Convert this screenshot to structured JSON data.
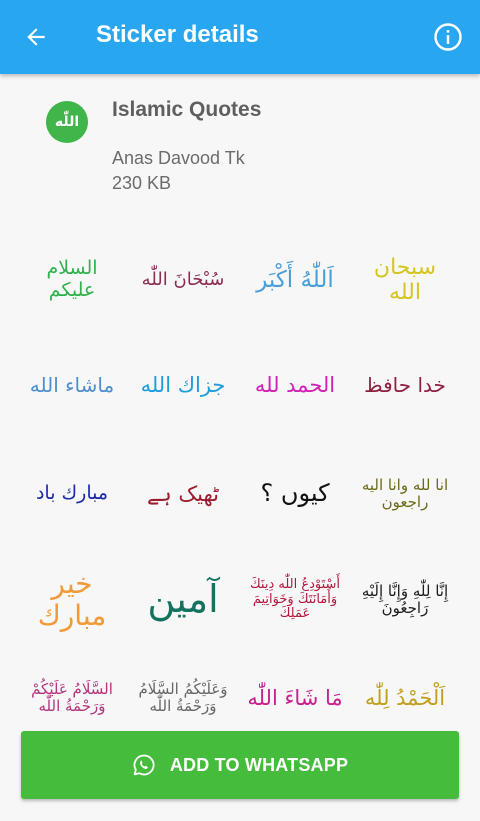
{
  "appbar": {
    "title": "Sticker details",
    "back_icon": "arrow-left-icon",
    "info_icon": "info-icon"
  },
  "pack": {
    "icon_text": "اللّٰه",
    "name": "Islamic Quotes",
    "author": "Anas Davood Tk",
    "size": "230 KB"
  },
  "stickers": [
    {
      "text": "السلام عليكم",
      "color": "#2db34a"
    },
    {
      "text": "سُبْحَانَ اللّٰه",
      "color": "#8c2d55"
    },
    {
      "text": "اَللّٰهُ أَكْبَر",
      "color": "#4a9fd8"
    },
    {
      "text": "سبحان الله",
      "color": "#d5c51f"
    },
    {
      "text": "ماشاء الله",
      "color": "#4f8fcf"
    },
    {
      "text": "جزاك الله",
      "color": "#1e9dd8"
    },
    {
      "text": "الحمد لله",
      "color": "#d21fb6"
    },
    {
      "text": "خدا حافظ",
      "color": "#8e1f3f"
    },
    {
      "text": "مبارك باد",
      "color": "#1c2aa8"
    },
    {
      "text": "ٹھیک ہے",
      "color": "#9c1c2e"
    },
    {
      "text": "کیوں ؟",
      "color": "#111111"
    },
    {
      "text": "انا لله وانا اليه راجعون",
      "color": "#6c6a16"
    },
    {
      "text": "خير مبارك",
      "color": "#f19a3a"
    },
    {
      "text": "آمين",
      "color": "#14735e"
    },
    {
      "text": "أَسْتَوْدِعُ اللّٰه دِينَكَ وَأَمَانَتَكَ وَخَوَاتِيمَ عَمَلِكَ",
      "color": "#b3163d"
    },
    {
      "text": "إِنَّا لِلّٰهِ وَإِنَّا إِلَيْهِ رَاجِعُونَ",
      "color": "#1c1c1c"
    },
    {
      "text": "السَّلَامُ عَلَيْكُمْ وَرَحْمَةُ اللّٰه",
      "color": "#b3347d"
    },
    {
      "text": "وَعَلَيْكُمُ السَّلَامُ وَرَحْمَةُ اللّٰه",
      "color": "#666666"
    },
    {
      "text": "مَا شَاءَ اللّٰه",
      "color": "#c8208f"
    },
    {
      "text": "اَلْحَمْدُ لِلّٰه",
      "color": "#c2a01d"
    }
  ],
  "add_button": {
    "label": "ADD TO WHATSAPP",
    "icon": "whatsapp-icon"
  }
}
